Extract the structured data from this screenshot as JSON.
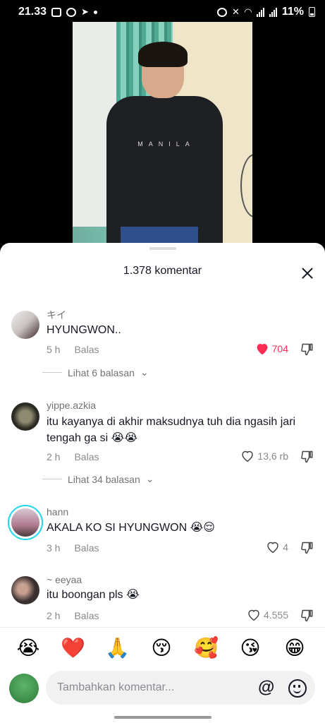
{
  "status_bar": {
    "time": "21.33",
    "battery": "11%"
  },
  "sheet": {
    "title": "1.378 komentar"
  },
  "comments": [
    {
      "username": "キイ",
      "text": "HYUNGWON..",
      "age": "5 h",
      "reply": "Balas",
      "likes": "704",
      "liked": true,
      "view_replies": "Lihat 6 balasan"
    },
    {
      "username": "yippe.azkia",
      "text": "itu kayanya di akhir maksudnya tuh dia ngasih jari tengah ga si 😭😭",
      "age": "2 h",
      "reply": "Balas",
      "likes": "13,6 rb",
      "liked": false,
      "view_replies": "Lihat 34 balasan"
    },
    {
      "username": "hann",
      "text": "AKALA KO SI HYUNGWON 😭😌",
      "age": "3 h",
      "reply": "Balas",
      "likes": "4",
      "liked": false
    },
    {
      "username": "~ eeyaa",
      "text": "itu boongan pls 😭",
      "age": "2 h",
      "reply": "Balas",
      "likes": "4.555",
      "liked": false
    }
  ],
  "emoji_bar": [
    "😭",
    "❤️",
    "🙏",
    "😚",
    "🥰",
    "😘",
    "😁"
  ],
  "input": {
    "placeholder": "Tambahkan komentar...",
    "at": "@"
  },
  "video": {
    "hoodie_text": "MANILA"
  },
  "colors": {
    "like_red": "#fe2c55",
    "ring": "#20d5ec"
  }
}
